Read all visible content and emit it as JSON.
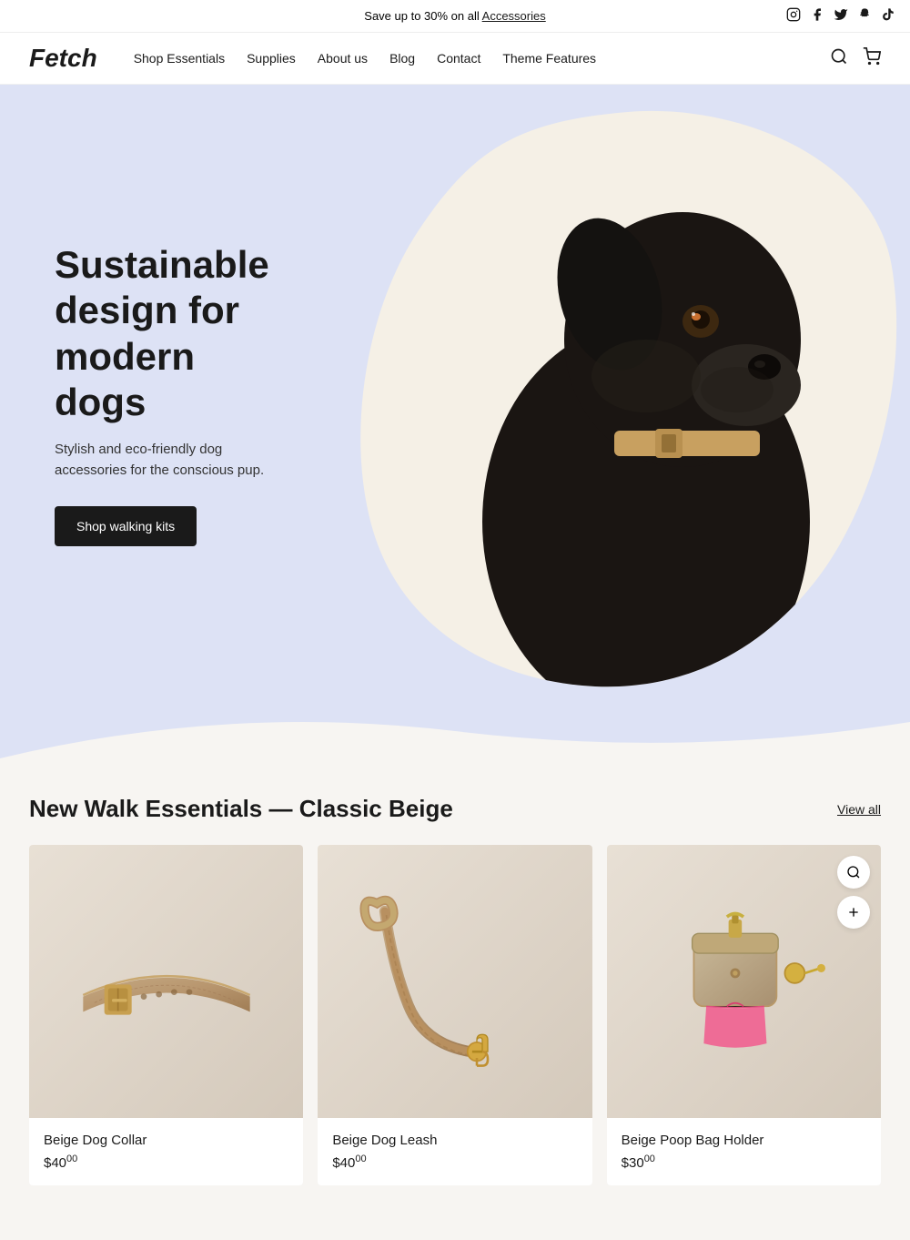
{
  "announcement": {
    "text": "Save up to 30% on all ",
    "link_text": "Accessories"
  },
  "social_icons": [
    {
      "name": "instagram-icon",
      "symbol": "📷"
    },
    {
      "name": "facebook-icon",
      "symbol": "f"
    },
    {
      "name": "twitter-icon",
      "symbol": "𝕏"
    },
    {
      "name": "snapchat-icon",
      "symbol": "👻"
    },
    {
      "name": "tiktok-icon",
      "symbol": "♪"
    }
  ],
  "header": {
    "logo": "Fetch",
    "nav_items": [
      {
        "label": "Shop Essentials",
        "name": "nav-shop-essentials"
      },
      {
        "label": "Supplies",
        "name": "nav-supplies"
      },
      {
        "label": "About us",
        "name": "nav-about"
      },
      {
        "label": "Blog",
        "name": "nav-blog"
      },
      {
        "label": "Contact",
        "name": "nav-contact"
      },
      {
        "label": "Theme Features",
        "name": "nav-theme-features"
      }
    ]
  },
  "hero": {
    "title": "Sustainable design for modern dogs",
    "subtitle": "Stylish and eco-friendly dog accessories for the conscious pup.",
    "cta_label": "Shop walking kits"
  },
  "products_section": {
    "title": "New Walk Essentials — Classic Beige",
    "view_all_label": "View all",
    "products": [
      {
        "name": "Beige Dog Collar",
        "price_dollars": "$40",
        "price_cents": "00",
        "image_type": "collar"
      },
      {
        "name": "Beige Dog Leash",
        "price_dollars": "$40",
        "price_cents": "00",
        "image_type": "leash"
      },
      {
        "name": "Beige Poop Bag Holder",
        "price_dollars": "$30",
        "price_cents": "00",
        "image_type": "poop-bag"
      }
    ]
  }
}
